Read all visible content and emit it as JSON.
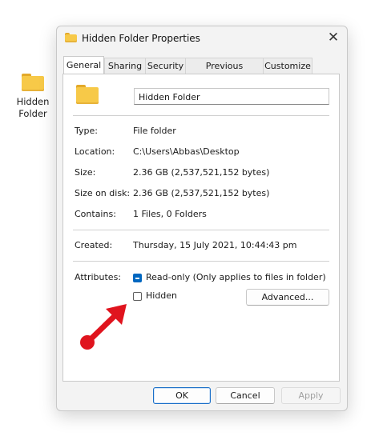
{
  "desktop": {
    "icon_label_line1": "Hidden",
    "icon_label_line2": "Folder"
  },
  "window": {
    "title": "Hidden Folder Properties",
    "close_glyph": "✕"
  },
  "tabs": [
    {
      "label": "General",
      "active": true
    },
    {
      "label": "Sharing"
    },
    {
      "label": "Security"
    },
    {
      "label": "Previous Versions"
    },
    {
      "label": "Customize"
    }
  ],
  "general": {
    "folder_name": "Hidden Folder",
    "rows": [
      {
        "label": "Type:",
        "value": "File folder"
      },
      {
        "label": "Location:",
        "value": "C:\\Users\\Abbas\\Desktop"
      },
      {
        "label": "Size:",
        "value": "2.36 GB (2,537,521,152 bytes)"
      },
      {
        "label": "Size on disk:",
        "value": "2.36 GB (2,537,521,152 bytes)"
      },
      {
        "label": "Contains:",
        "value": "1 Files, 0 Folders"
      }
    ],
    "created_label": "Created:",
    "created_value": "Thursday, 15 July 2021, 10:44:43 pm",
    "attributes_label": "Attributes:",
    "readonly_label": "Read-only (Only applies to files in folder)",
    "readonly_state": "indeterminate",
    "hidden_label": "Hidden",
    "hidden_checked": false,
    "advanced_label": "Advanced..."
  },
  "footer": {
    "ok_label": "OK",
    "cancel_label": "Cancel",
    "apply_label": "Apply"
  },
  "colors": {
    "accent": "#0067c0",
    "folder": "#f7c948",
    "annotation_arrow": "#e0141e"
  },
  "icons": {
    "folder": "folder-icon",
    "close": "close-icon",
    "arrow": "red-arrow-annotation"
  }
}
